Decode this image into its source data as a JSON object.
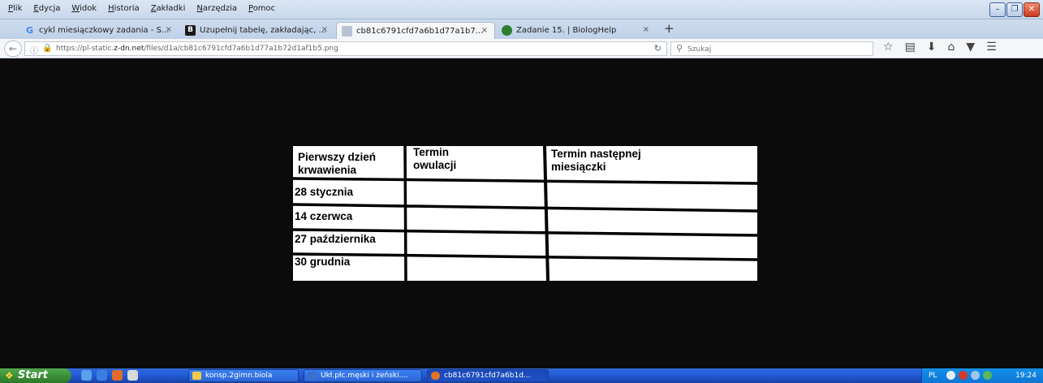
{
  "menu": [
    "Plik",
    "Edycja",
    "Widok",
    "Historia",
    "Zakładki",
    "Narzędzia",
    "Pomoc"
  ],
  "tabs": [
    {
      "title": "cykl miesiączkowy zadania - S...",
      "favicon": "google-favicon",
      "color": "#4285f4",
      "active": false
    },
    {
      "title": "Uzupełnij tabelę, zakładając, ...",
      "favicon": "brainly-favicon",
      "color": "#1a1a1a",
      "active": false
    },
    {
      "title": "cb81c6791cfd7a6b1d77a1b7...",
      "favicon": "image-favicon",
      "color": "#b7c3d3",
      "active": true
    },
    {
      "title": "Zadanie 15. | BiologHelp",
      "favicon": "biologhelp-favicon",
      "color": "#2e7d32",
      "active": false
    }
  ],
  "tab_close": "×",
  "new_tab": "+",
  "nav": {
    "url_host": "https://pl-static.",
    "url_domain": "z-dn.net",
    "url_path": "/files/d1a/cb81c6791cfd7a6b1d77a1b72d1af1b5.png",
    "search_placeholder": "Szukaj"
  },
  "table": {
    "headers": [
      [
        "Pierwszy dzień",
        "krwawienia"
      ],
      [
        "Termin",
        "owulacji"
      ],
      [
        "Termin następnej",
        "miesiączki"
      ]
    ],
    "rows": [
      "28 stycznia",
      "14 czerwca",
      "27 października",
      "30 grudnia"
    ]
  },
  "taskbar": {
    "start": "Start",
    "tasks": [
      {
        "label": "konsp.2gimn.biola",
        "icon_color": "#f2c94c",
        "active": false
      },
      {
        "label": "Ukł.płc.męski i żeński....",
        "icon_color": "#3b6fd1",
        "active": false
      },
      {
        "label": "cb81c6791cfd7a6b1d...",
        "icon_color": "#e8731c",
        "active": true
      }
    ],
    "lang": "PL",
    "clock": "19:24"
  }
}
